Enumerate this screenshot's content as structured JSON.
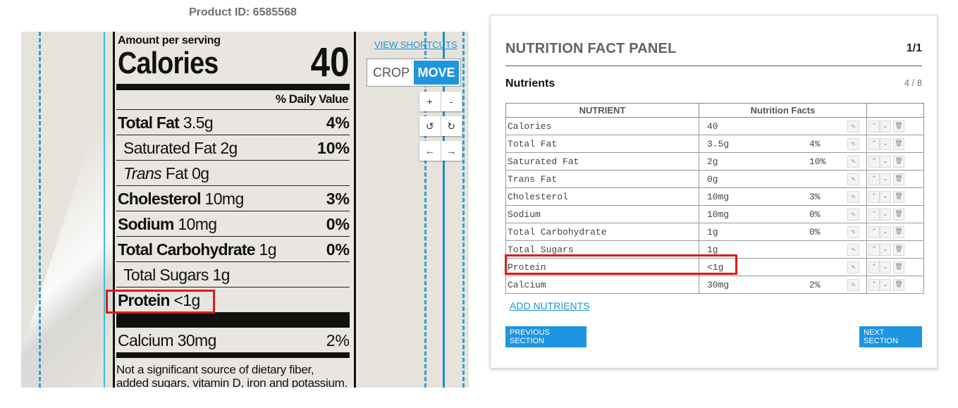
{
  "product_id": "Product ID: 6585568",
  "viewer": {
    "shortcuts_label": "VIEW SHORTCUTS",
    "crop_label": "CROP",
    "move_label": "MOVE",
    "zoom_in": "+",
    "zoom_out": "-",
    "rotate_left": "↺",
    "rotate_right": "↻",
    "pan_left": "←",
    "pan_right": "→",
    "label_image": {
      "amount_per_serving": "Amount per serving",
      "calories_label": "Calories",
      "calories_value": "40",
      "daily_value_header": "% Daily Value",
      "rows": [
        {
          "name_bold": "Total Fat",
          "name_rest": " 3.5g",
          "percent": "4%"
        },
        {
          "name_bold": "",
          "name_rest": "Saturated Fat 2g",
          "percent": "10%"
        },
        {
          "name_bold": "",
          "name_italic": "Trans",
          "name_rest": " Fat 0g",
          "percent": ""
        },
        {
          "name_bold": "Cholesterol",
          "name_rest": " 10mg",
          "percent": "3%"
        },
        {
          "name_bold": "Sodium",
          "name_rest": " 10mg",
          "percent": "0%"
        },
        {
          "name_bold": "Total Carbohydrate",
          "name_rest": " 1g",
          "percent": "0%"
        },
        {
          "name_bold": "",
          "name_rest": "Total Sugars 1g",
          "percent": ""
        },
        {
          "name_bold": "Protein",
          "name_rest": " <1g",
          "percent": ""
        }
      ],
      "calcium": {
        "name": "Calcium 30mg",
        "percent": "2%"
      },
      "footnote": [
        "Not a significant source of dietary fiber,",
        "added sugars, vitamin D, iron and potassium."
      ]
    }
  },
  "panel": {
    "title": "NUTRITION FACT PANEL",
    "page": "1/1",
    "section_title": "Nutrients",
    "section_count": "4 / 8",
    "columns": [
      "NUTRIENT",
      "Nutrition Facts",
      ""
    ],
    "rows": [
      {
        "name": "Calories",
        "value": "40",
        "percent": ""
      },
      {
        "name": "Total Fat",
        "value": "3.5g",
        "percent": "4%"
      },
      {
        "name": "Saturated Fat",
        "value": "2g",
        "percent": "10%"
      },
      {
        "name": "Trans Fat",
        "value": "0g",
        "percent": ""
      },
      {
        "name": "Cholesterol",
        "value": "10mg",
        "percent": "3%"
      },
      {
        "name": "Sodium",
        "value": "10mg",
        "percent": "0%"
      },
      {
        "name": "Total Carbohydrate",
        "value": "1g",
        "percent": "0%"
      },
      {
        "name": "Total Sugars",
        "value": "1g",
        "percent": ""
      },
      {
        "name": "Protein",
        "value": "<1g",
        "percent": ""
      },
      {
        "name": "Calcium",
        "value": "30mg",
        "percent": "2%"
      }
    ],
    "icons": {
      "edit": "✎",
      "up": "⌃",
      "down": "⌄",
      "delete": "🗑"
    },
    "add_nutrients": "ADD NUTRIENTS",
    "previous_section": "PREVIOUS SECTION",
    "next_section": "NEXT SECTION"
  },
  "colors": {
    "accent": "#1e95e0",
    "highlight": "#e51515",
    "guide": "#32c5d6"
  }
}
